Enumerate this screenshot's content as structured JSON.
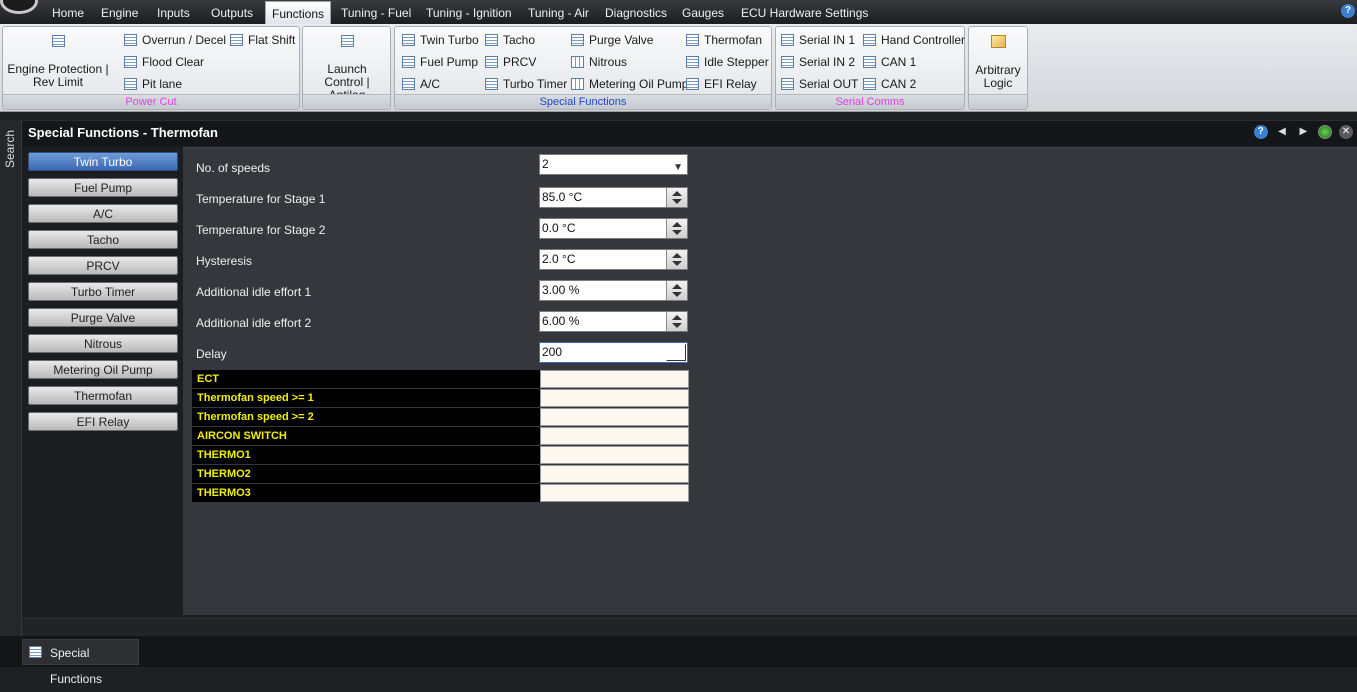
{
  "menu": {
    "items": [
      "Home",
      "Engine",
      "Inputs",
      "Outputs",
      "Functions",
      "Tuning - Fuel",
      "Tuning - Ignition",
      "Tuning - Air",
      "Diagnostics",
      "Gauges",
      "ECU Hardware Settings"
    ],
    "active": "Functions",
    "help_label": "?"
  },
  "ribbon": {
    "power_cut": {
      "label": "Power Cut",
      "engine_protection": "Engine Protection | Rev Limit",
      "overrun": "Overrun / Decel",
      "flat_shift": "Flat Shift",
      "flood_clear": "Flood Clear",
      "pit_lane": "Pit lane"
    },
    "launch_control": "Launch Control | Antilag",
    "special_functions": {
      "label": "Special Functions",
      "twin_turbo": "Twin Turbo",
      "tacho": "Tacho",
      "purge_valve": "Purge Valve",
      "thermofan": "Thermofan",
      "fuel_pump": "Fuel Pump",
      "prcv": "PRCV",
      "nitrous": "Nitrous",
      "idle_stepper": "Idle Stepper",
      "ac": "A/C",
      "turbo_timer": "Turbo Timer",
      "metering_oil_pump": "Metering Oil Pump",
      "efi_relay": "EFI Relay"
    },
    "serial_comms": {
      "label": "Serial Comms",
      "serial_in_1": "Serial IN 1",
      "hand_controller": "Hand Controller",
      "serial_in_2": "Serial IN 2",
      "can_1": "CAN 1",
      "serial_out": "Serial OUT",
      "can_2": "CAN 2"
    },
    "arbitrary_logic": "Arbitrary Logic"
  },
  "search_tab": "Search",
  "page": {
    "title": "Special Functions - Thermofan"
  },
  "nav": {
    "items": [
      "Twin Turbo",
      "Fuel Pump",
      "A/C",
      "Tacho",
      "PRCV",
      "Turbo Timer",
      "Purge Valve",
      "Nitrous",
      "Metering Oil Pump",
      "Thermofan",
      "EFI Relay"
    ],
    "active": "Twin Turbo"
  },
  "settings": {
    "no_of_speeds": {
      "label": "No. of speeds",
      "value": "2"
    },
    "temp_stage_1": {
      "label": "Temperature for Stage 1",
      "value": "85.0 °C"
    },
    "temp_stage_2": {
      "label": "Temperature for Stage 2",
      "value": "0.0 °C"
    },
    "hysteresis": {
      "label": "Hysteresis",
      "value": "2.0 °C"
    },
    "idle_effort_1": {
      "label": "Additional idle effort 1",
      "value": "3.00 %"
    },
    "idle_effort_2": {
      "label": "Additional idle effort 2",
      "value": "6.00 %"
    },
    "delay": {
      "label": "Delay",
      "value": "200"
    }
  },
  "channels": [
    "ECT",
    "Thermofan speed >= 1",
    "Thermofan speed >= 2",
    "AIRCON SWITCH",
    "THERMO1",
    "THERMO2",
    "THERMO3"
  ],
  "bottom_tab": "Special Functions",
  "colors": {
    "accent": "#3a69b2",
    "channel_text": "#f0f000",
    "group_label_magenta": "#e040e0",
    "group_label_blue": "#2246c8"
  }
}
